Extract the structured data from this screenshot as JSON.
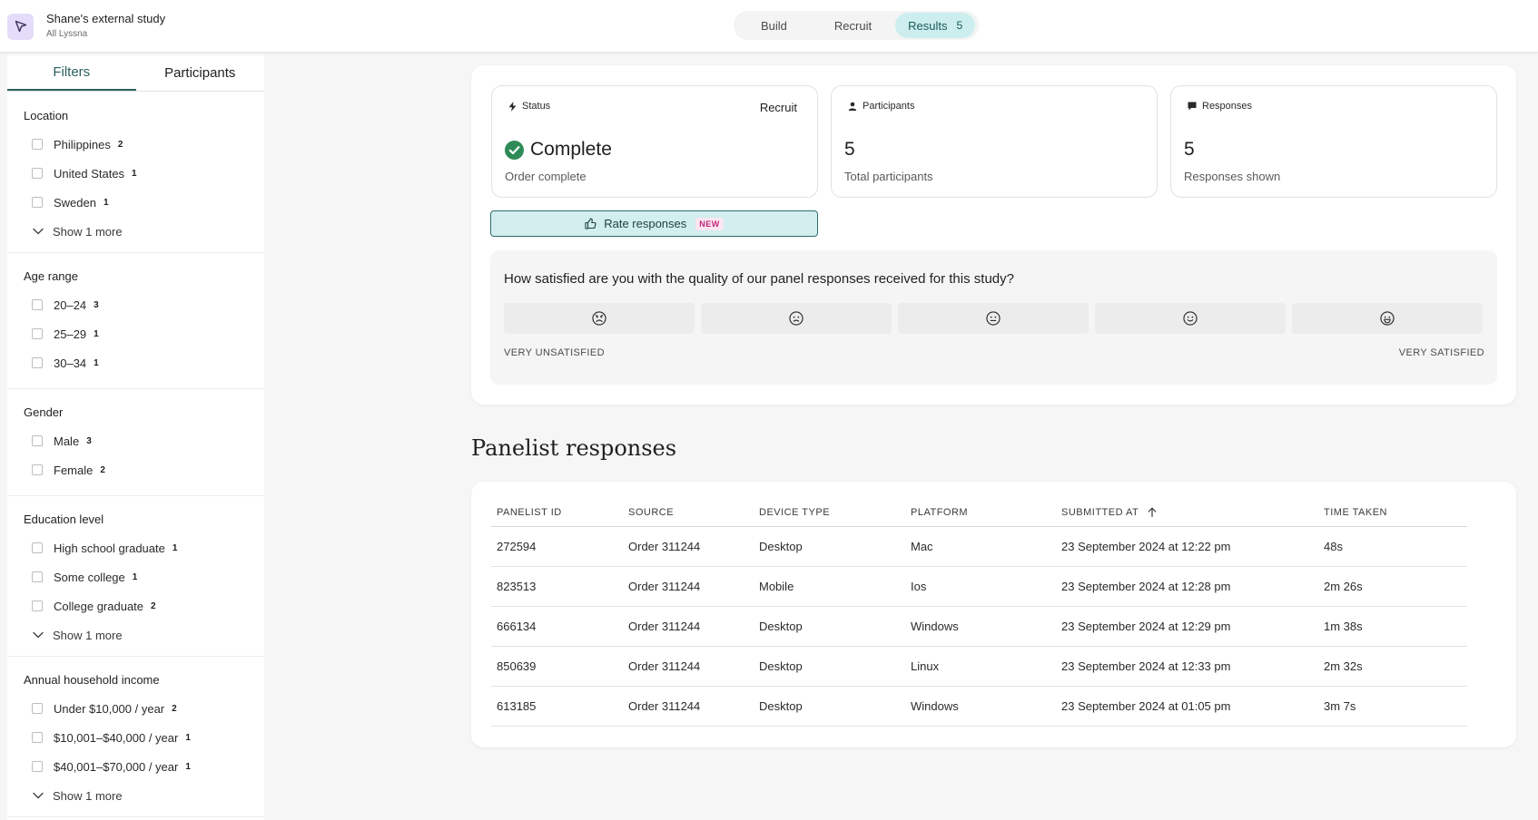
{
  "header": {
    "study_title": "Shane's external study",
    "study_subtitle": "All Lyssna",
    "nav": [
      {
        "label": "Build"
      },
      {
        "label": "Recruit"
      },
      {
        "label": "Results",
        "badge": "5"
      }
    ]
  },
  "sidebar": {
    "tabs": [
      "Filters",
      "Participants"
    ],
    "sections": [
      {
        "title": "Location",
        "options": [
          {
            "label": "Philippines",
            "count": "2"
          },
          {
            "label": "United States",
            "count": "1"
          },
          {
            "label": "Sweden",
            "count": "1"
          }
        ],
        "show_more": "Show 1 more"
      },
      {
        "title": "Age range",
        "options": [
          {
            "label": "20–24",
            "count": "3"
          },
          {
            "label": "25–29",
            "count": "1"
          },
          {
            "label": "30–34",
            "count": "1"
          }
        ]
      },
      {
        "title": "Gender",
        "options": [
          {
            "label": "Male",
            "count": "3"
          },
          {
            "label": "Female",
            "count": "2"
          }
        ]
      },
      {
        "title": "Education level",
        "options": [
          {
            "label": "High school graduate",
            "count": "1"
          },
          {
            "label": "Some college",
            "count": "1"
          },
          {
            "label": "College graduate",
            "count": "2"
          }
        ],
        "show_more": "Show 1 more"
      },
      {
        "title": "Annual household income",
        "options": [
          {
            "label": "Under $10,000 / year",
            "count": "2"
          },
          {
            "label": "$10,001–$40,000 / year",
            "count": "1"
          },
          {
            "label": "$40,001–$70,000 / year",
            "count": "1"
          }
        ],
        "show_more": "Show 1 more"
      }
    ]
  },
  "stats": {
    "status": {
      "label": "Status",
      "link": "Recruit",
      "value": "Complete",
      "sub": "Order complete"
    },
    "participants": {
      "label": "Participants",
      "value": "5",
      "sub": "Total participants"
    },
    "responses": {
      "label": "Responses",
      "value": "5",
      "sub": "Responses shown"
    }
  },
  "rate_button": {
    "label": "Rate responses",
    "badge": "NEW"
  },
  "survey": {
    "question": "How satisfied are you with the quality of our panel responses received for this study?",
    "low_label": "VERY UNSATISFIED",
    "high_label": "VERY SATISFIED",
    "faces": [
      "very-unsatisfied-face-icon",
      "unsatisfied-face-icon",
      "neutral-face-icon",
      "satisfied-face-icon",
      "very-satisfied-face-icon"
    ]
  },
  "responses_section": {
    "title": "Panelist responses",
    "columns": [
      "PANELIST ID",
      "SOURCE",
      "DEVICE TYPE",
      "PLATFORM",
      "SUBMITTED AT",
      "TIME TAKEN"
    ],
    "rows": [
      [
        "272594",
        "Order 311244",
        "Desktop",
        "Mac",
        "23 September 2024 at 12:22 pm",
        "48s"
      ],
      [
        "823513",
        "Order 311244",
        "Mobile",
        "Ios",
        "23 September 2024 at 12:28 pm",
        "2m 26s"
      ],
      [
        "666134",
        "Order 311244",
        "Desktop",
        "Windows",
        "23 September 2024 at 12:29 pm",
        "1m 38s"
      ],
      [
        "850639",
        "Order 311244",
        "Desktop",
        "Linux",
        "23 September 2024 at 12:33 pm",
        "2m 32s"
      ],
      [
        "613185",
        "Order 311244",
        "Desktop",
        "Windows",
        "23 September 2024 at 01:05 pm",
        "3m 7s"
      ]
    ]
  },
  "colors": {
    "accent": "#2b6160",
    "success": "#2e8b57",
    "nav_active_bg": "#cdeeee",
    "badge_pink": "#c3287a"
  }
}
